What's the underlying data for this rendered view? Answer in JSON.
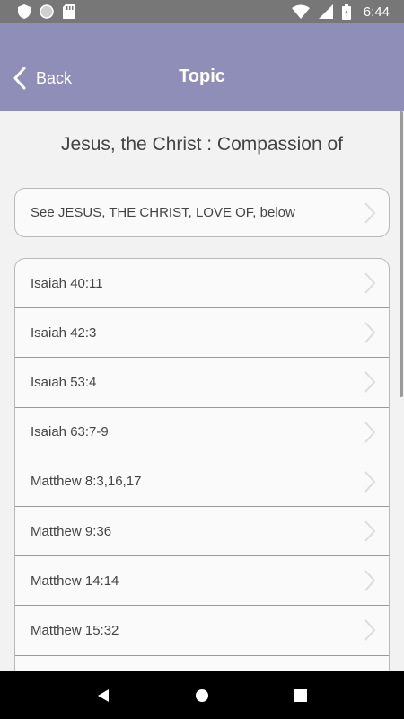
{
  "status_bar": {
    "time": "6:44",
    "icons": [
      "shield-icon",
      "circle-icon",
      "sd-card-icon",
      "wifi-icon",
      "signal-icon",
      "battery-icon"
    ]
  },
  "header": {
    "back_label": "Back",
    "title": "Topic",
    "background": "#8e8eb9"
  },
  "topic": {
    "heading": "Jesus, the Christ : Compassion of",
    "see_also": "See JESUS, THE CHRIST, LOVE OF, below"
  },
  "references": [
    {
      "label": "Isaiah 40:11"
    },
    {
      "label": "Isaiah 42:3"
    },
    {
      "label": "Isaiah 53:4"
    },
    {
      "label": "Isaiah 63:7-9"
    },
    {
      "label": "Matthew 8:3,16,17"
    },
    {
      "label": "Matthew 9:36"
    },
    {
      "label": "Matthew 14:14"
    },
    {
      "label": "Matthew 15:32"
    },
    {
      "label": ""
    }
  ],
  "nav_bar": {
    "buttons": [
      "back-triangle-icon",
      "home-circle-icon",
      "recents-square-icon"
    ]
  }
}
